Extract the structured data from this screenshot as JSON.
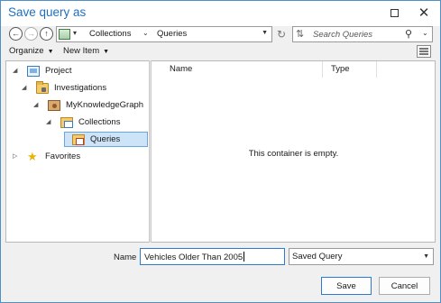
{
  "window": {
    "title": "Save query as"
  },
  "nav": {
    "back_glyph": "←",
    "forward_glyph": "→",
    "up_glyph": "↑",
    "breadcrumbs": [
      "Collections",
      "Queries"
    ],
    "refresh_glyph": "↻",
    "search_placeholder": "Search Queries",
    "search_glyph": "⚲"
  },
  "commands": {
    "organize": "Organize",
    "new_item": "New Item"
  },
  "tree": {
    "items": [
      {
        "label": "Project",
        "icon": "project-icon",
        "expanded": true
      },
      {
        "label": "Investigations",
        "icon": "folder-lock-icon",
        "expanded": true
      },
      {
        "label": "MyKnowledgeGraph",
        "icon": "knowledge-graph-icon",
        "expanded": true
      },
      {
        "label": "Collections",
        "icon": "collection-icon",
        "expanded": true
      },
      {
        "label": "Queries",
        "icon": "query-folder-icon",
        "selected": true
      },
      {
        "label": "Favorites",
        "icon": "star-icon",
        "expanded": false
      }
    ]
  },
  "content": {
    "columns": [
      "Name",
      "Type"
    ],
    "empty_message": "This container is empty."
  },
  "form": {
    "name_label": "Name",
    "name_value": "Vehicles Older Than 2005",
    "type_value": "Saved Query"
  },
  "buttons": {
    "save": "Save",
    "cancel": "Cancel"
  },
  "colors": {
    "accent": "#1f6fbf",
    "selection": "#cde3f7",
    "border": "#4f90c9"
  }
}
